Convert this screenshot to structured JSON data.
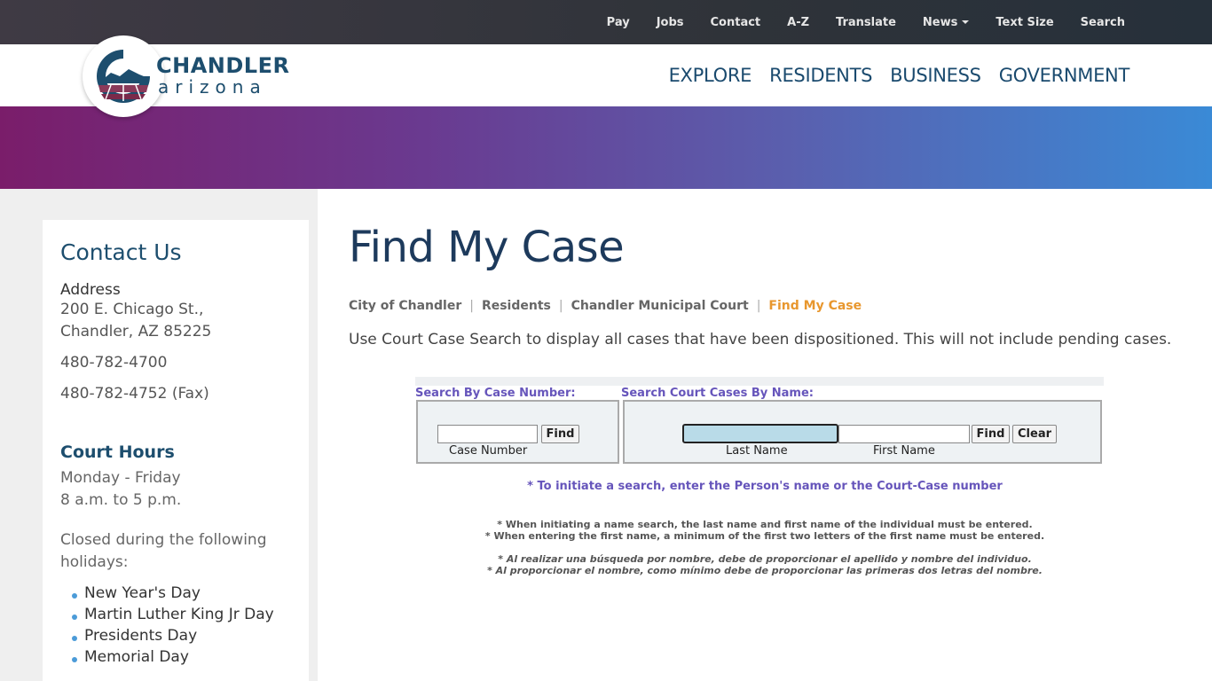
{
  "topbar": {
    "items": [
      "Pay",
      "Jobs",
      "Contact",
      "A-Z",
      "Translate",
      "News",
      "Text Size",
      "Search"
    ]
  },
  "logo": {
    "line1": "CHANDLER",
    "line2": "arizona"
  },
  "mainnav": {
    "items": [
      "EXPLORE",
      "RESIDENTS",
      "BUSINESS",
      "GOVERNMENT"
    ]
  },
  "sidebar": {
    "title": "Contact Us",
    "address_label": "Address",
    "address_line1": "200 E. Chicago St.,",
    "address_line2": "Chandler, AZ 85225",
    "phone": "480-782-4700",
    "fax": "480-782-4752 (Fax)",
    "hours_title": "Court Hours",
    "hours_days": "Monday - Friday",
    "hours_time": "8 a.m. to 5 p.m.",
    "closed_text": "Closed during the following holidays:",
    "holidays": [
      "New Year's Day",
      "Martin Luther King Jr Day",
      "Presidents Day",
      "Memorial Day"
    ]
  },
  "page": {
    "title": "Find My Case",
    "breadcrumb": [
      "City of Chandler",
      "Residents",
      "Chandler Municipal Court",
      "Find My Case"
    ],
    "intro": "Use Court Case Search to display all cases that have been dispositioned. This will not include pending cases."
  },
  "search": {
    "by_case_label": "Search By Case Number:",
    "by_name_label": "Search Court Cases By Name:",
    "case_number_value": "",
    "case_number_caption": "Case Number",
    "last_name_value": "",
    "last_name_caption": "Last Name",
    "first_name_value": "",
    "first_name_caption": "First Name",
    "find_label": "Find",
    "clear_label": "Clear",
    "instruction": "* To initiate a search, enter the Person's name or the Court-Case number",
    "note_en_1": "* When initiating a name search, the last name and first name of the individual must be entered.",
    "note_en_2": "* When entering the first name, a minimum of the first two letters of the first name must be entered.",
    "note_es_1": "* Al realizar una búsqueda por nombre, debe de proporcionar el apellido y nombre del individuo.",
    "note_es_2": "* Al proporcionar el nombre, como mínimo debe de proporcionar las primeras dos letras del nombre."
  }
}
